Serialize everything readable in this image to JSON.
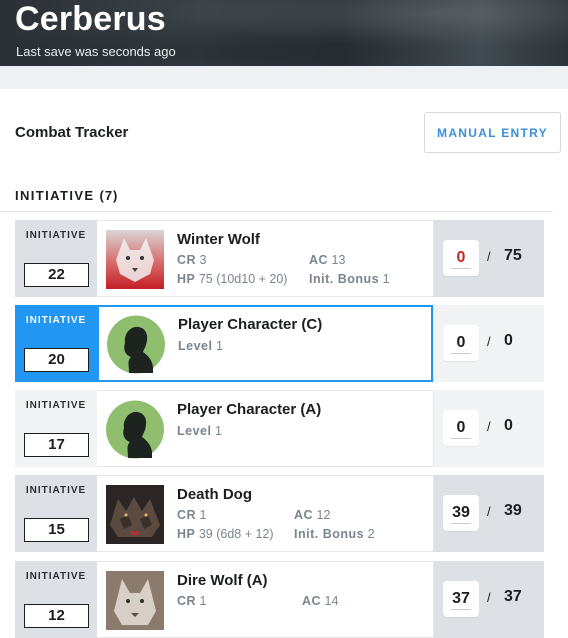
{
  "app": {
    "title": "Cerberus",
    "save_status": "Last save was seconds ago"
  },
  "tracker": {
    "title": "Combat Tracker",
    "manual_entry": "MANUAL ENTRY"
  },
  "initiative": {
    "label": "INITIATIVE",
    "count": "(7)"
  },
  "labels": {
    "initiative": "INITIATIVE",
    "cr": "CR",
    "ac": "AC",
    "hp": "HP",
    "init_bonus": "Init. Bonus",
    "level": "Level",
    "slash": "/"
  },
  "colors": {
    "accent": "#2196f3",
    "hp_zero": "#c62828",
    "brand_button_text": "#3b8fd9"
  },
  "combatants": [
    {
      "initiative": "22",
      "name": "Winter Wolf",
      "cr": "3",
      "ac": "13",
      "hp": "75 (10d10 + 20)",
      "init_bonus": "1",
      "hp_current": "0",
      "hp_max": "75",
      "portrait_icon": "winter-wolf-portrait"
    },
    {
      "initiative": "20",
      "name": "Player Character (C)",
      "level": "1",
      "hp_current": "0",
      "hp_max": "0",
      "portrait_icon": "player-silhouette-icon",
      "active": true
    },
    {
      "initiative": "17",
      "name": "Player Character (A)",
      "level": "1",
      "hp_current": "0",
      "hp_max": "0",
      "portrait_icon": "player-silhouette-icon"
    },
    {
      "initiative": "15",
      "name": "Death Dog",
      "cr": "1",
      "ac": "12",
      "hp": "39 (6d8 + 12)",
      "init_bonus": "2",
      "hp_current": "39",
      "hp_max": "39",
      "portrait_icon": "death-dog-portrait"
    },
    {
      "initiative": "12",
      "name": "Dire Wolf (A)",
      "cr": "1",
      "ac": "14",
      "hp_current": "37",
      "hp_max": "37",
      "portrait_icon": "dire-wolf-portrait"
    }
  ]
}
